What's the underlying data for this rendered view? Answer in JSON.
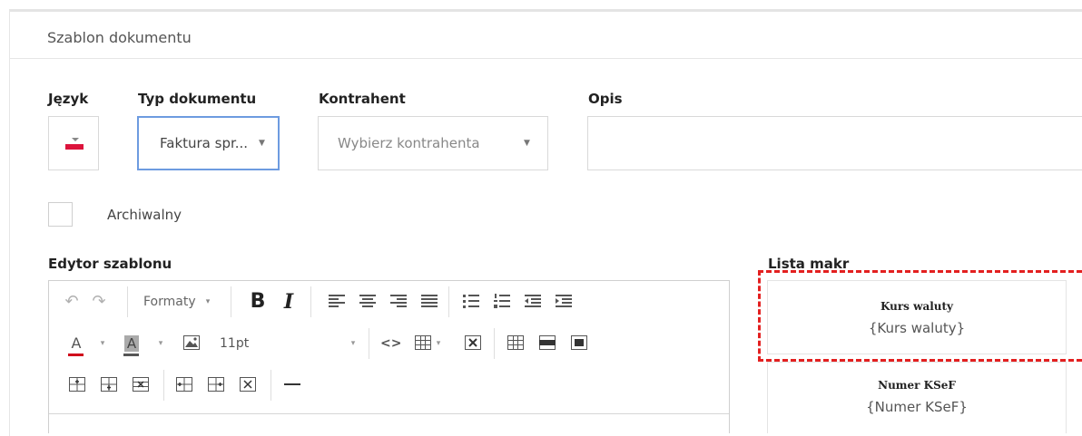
{
  "panel": {
    "title": "Szablon dokumentu"
  },
  "form": {
    "language_label": "Język",
    "doc_type_label": "Typ dokumentu",
    "doc_type_value": "Faktura spr...",
    "contractor_label": "Kontrahent",
    "contractor_placeholder": "Wybierz kontrahenta",
    "description_label": "Opis",
    "description_value": "",
    "archived_label": "Archiwalny"
  },
  "editor": {
    "label": "Edytor szablonu",
    "formats_label": "Formaty",
    "font_size": "11pt",
    "bold_glyph": "B",
    "italic_glyph": "I",
    "font_color_glyph": "A",
    "bg_color_glyph": "A",
    "font_color_hex": "#d0021b",
    "bg_color_hex": "#555555"
  },
  "macros": {
    "label": "Lista makr",
    "items": [
      {
        "name": "Kurs waluty",
        "value": "{Kurs waluty}"
      },
      {
        "name": "Numer KSeF",
        "value": "{Numer KSeF}"
      }
    ]
  },
  "colors": {
    "highlight": "#e32020",
    "focus_border": "#6d9be0"
  }
}
